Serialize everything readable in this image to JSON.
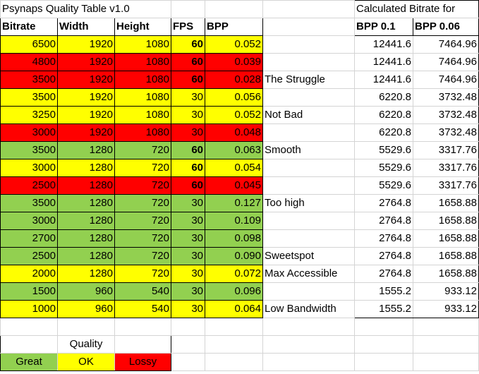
{
  "title": "Psynaps Quality Table v1.0",
  "calc_title": "Calculated Bitrate for",
  "headers": [
    "Bitrate",
    "Width",
    "Height",
    "FPS",
    "BPP"
  ],
  "calc_headers": [
    "BPP 0.1",
    "BPP 0.06"
  ],
  "colors": {
    "Y": "#ffff00",
    "R": "#ff0000",
    "G": "#92d050"
  },
  "rows": [
    {
      "q": "Y",
      "v": [
        "6500",
        "1920",
        "1080",
        "60",
        "0.052"
      ],
      "note": "",
      "c": [
        "12441.6",
        "7464.96"
      ]
    },
    {
      "q": "R",
      "v": [
        "4800",
        "1920",
        "1080",
        "60",
        "0.039"
      ],
      "note": "",
      "c": [
        "12441.6",
        "7464.96"
      ]
    },
    {
      "q": "R",
      "v": [
        "3500",
        "1920",
        "1080",
        "60",
        "0.028"
      ],
      "note": "The Struggle",
      "c": [
        "12441.6",
        "7464.96"
      ]
    },
    {
      "q": "Y",
      "v": [
        "3500",
        "1920",
        "1080",
        "30",
        "0.056"
      ],
      "note": "",
      "c": [
        "6220.8",
        "3732.48"
      ]
    },
    {
      "q": "Y",
      "v": [
        "3250",
        "1920",
        "1080",
        "30",
        "0.052"
      ],
      "note": "Not Bad",
      "c": [
        "6220.8",
        "3732.48"
      ]
    },
    {
      "q": "R",
      "v": [
        "3000",
        "1920",
        "1080",
        "30",
        "0.048"
      ],
      "note": "",
      "c": [
        "6220.8",
        "3732.48"
      ]
    },
    {
      "q": "G",
      "v": [
        "3500",
        "1280",
        "720",
        "60",
        "0.063"
      ],
      "note": "Smooth",
      "c": [
        "5529.6",
        "3317.76"
      ]
    },
    {
      "q": "Y",
      "v": [
        "3000",
        "1280",
        "720",
        "60",
        "0.054"
      ],
      "note": "",
      "c": [
        "5529.6",
        "3317.76"
      ]
    },
    {
      "q": "R",
      "v": [
        "2500",
        "1280",
        "720",
        "60",
        "0.045"
      ],
      "note": "",
      "c": [
        "5529.6",
        "3317.76"
      ]
    },
    {
      "q": "G",
      "v": [
        "3500",
        "1280",
        "720",
        "30",
        "0.127"
      ],
      "note": "Too high",
      "c": [
        "2764.8",
        "1658.88"
      ]
    },
    {
      "q": "G",
      "v": [
        "3000",
        "1280",
        "720",
        "30",
        "0.109"
      ],
      "note": "",
      "c": [
        "2764.8",
        "1658.88"
      ]
    },
    {
      "q": "G",
      "v": [
        "2700",
        "1280",
        "720",
        "30",
        "0.098"
      ],
      "note": "",
      "c": [
        "2764.8",
        "1658.88"
      ]
    },
    {
      "q": "G",
      "v": [
        "2500",
        "1280",
        "720",
        "30",
        "0.090"
      ],
      "note": "Sweetspot",
      "c": [
        "2764.8",
        "1658.88"
      ]
    },
    {
      "q": "Y",
      "v": [
        "2000",
        "1280",
        "720",
        "30",
        "0.072"
      ],
      "note": "Max Accessible",
      "c": [
        "2764.8",
        "1658.88"
      ]
    },
    {
      "q": "G",
      "v": [
        "1500",
        "960",
        "540",
        "30",
        "0.096"
      ],
      "note": "",
      "c": [
        "1555.2",
        "933.12"
      ]
    },
    {
      "q": "Y",
      "v": [
        "1000",
        "960",
        "540",
        "30",
        "0.064"
      ],
      "note": "Low Bandwidth",
      "c": [
        "1555.2",
        "933.12"
      ]
    }
  ],
  "legend": {
    "title": "Quality",
    "items": [
      {
        "label": "Great",
        "q": "G"
      },
      {
        "label": "OK",
        "q": "Y"
      },
      {
        "label": "Lossy",
        "q": "R"
      }
    ]
  }
}
